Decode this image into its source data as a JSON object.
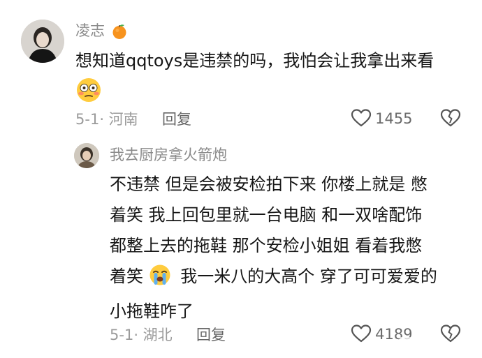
{
  "comment": {
    "username": "凌志",
    "username_badge_icon": "orange-emoji-icon",
    "text_line1": "想知道qqtoys是违禁的吗，我怕会让我拿出来看",
    "text_emoji_icon": "flushed-face-emoji-icon",
    "date": "5-1",
    "location": "河南",
    "reply_label": "回复",
    "like_count": "1455"
  },
  "reply": {
    "username": "我去厨房拿火箭炮",
    "lines": [
      "不违禁 但是会被安检拍下来 你楼上就是 憋",
      "着笑 我上回包里就一台电脑 和一双啥配饰",
      "都整上去的拖鞋 那个安检小姐姐 看着我憋",
      "着笑",
      "我一米八的大高个 穿了可可爱爱的",
      "小拖鞋咋了"
    ],
    "inline_emoji_icon": "loudly-crying-face-emoji-icon",
    "date": "5-1",
    "location": "湖北",
    "reply_label": "回复",
    "like_count": "4189"
  },
  "colors": {
    "text": "#161616",
    "meta": "#9b9b9b",
    "username": "#8a8a8a"
  }
}
